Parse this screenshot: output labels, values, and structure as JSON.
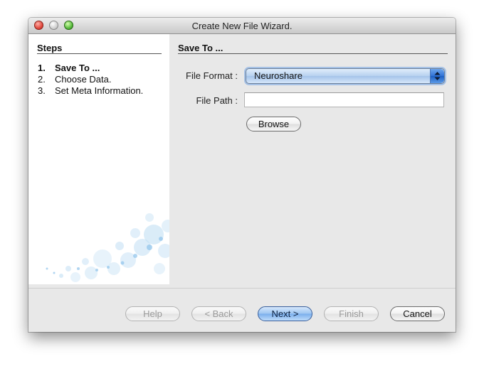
{
  "window": {
    "title": "Create New File Wizard."
  },
  "sidebar": {
    "heading": "Steps",
    "steps": [
      {
        "number": "1.",
        "label": "Save To ...",
        "active": true
      },
      {
        "number": "2.",
        "label": "Choose Data.",
        "active": false
      },
      {
        "number": "3.",
        "label": "Set Meta Information.",
        "active": false
      }
    ]
  },
  "main": {
    "heading": "Save To ...",
    "file_format": {
      "label": "File Format :",
      "value": "Neuroshare"
    },
    "file_path": {
      "label": "File Path :",
      "value": ""
    },
    "browse_label": "Browse"
  },
  "footer": {
    "help_label": "Help",
    "back_label": "< Back",
    "next_label": "Next >",
    "finish_label": "Finish",
    "cancel_label": "Cancel"
  },
  "icons": {
    "close": "close-button-icon",
    "minimize": "minimize-button-icon",
    "zoom": "zoom-button-icon",
    "select_arrows": "up-down-arrows-icon"
  },
  "colors": {
    "window_bg": "#e8e8e8",
    "sidebar_bg": "#ffffff",
    "default_button": "#79aeec",
    "select_accent": "#2f72d6"
  }
}
